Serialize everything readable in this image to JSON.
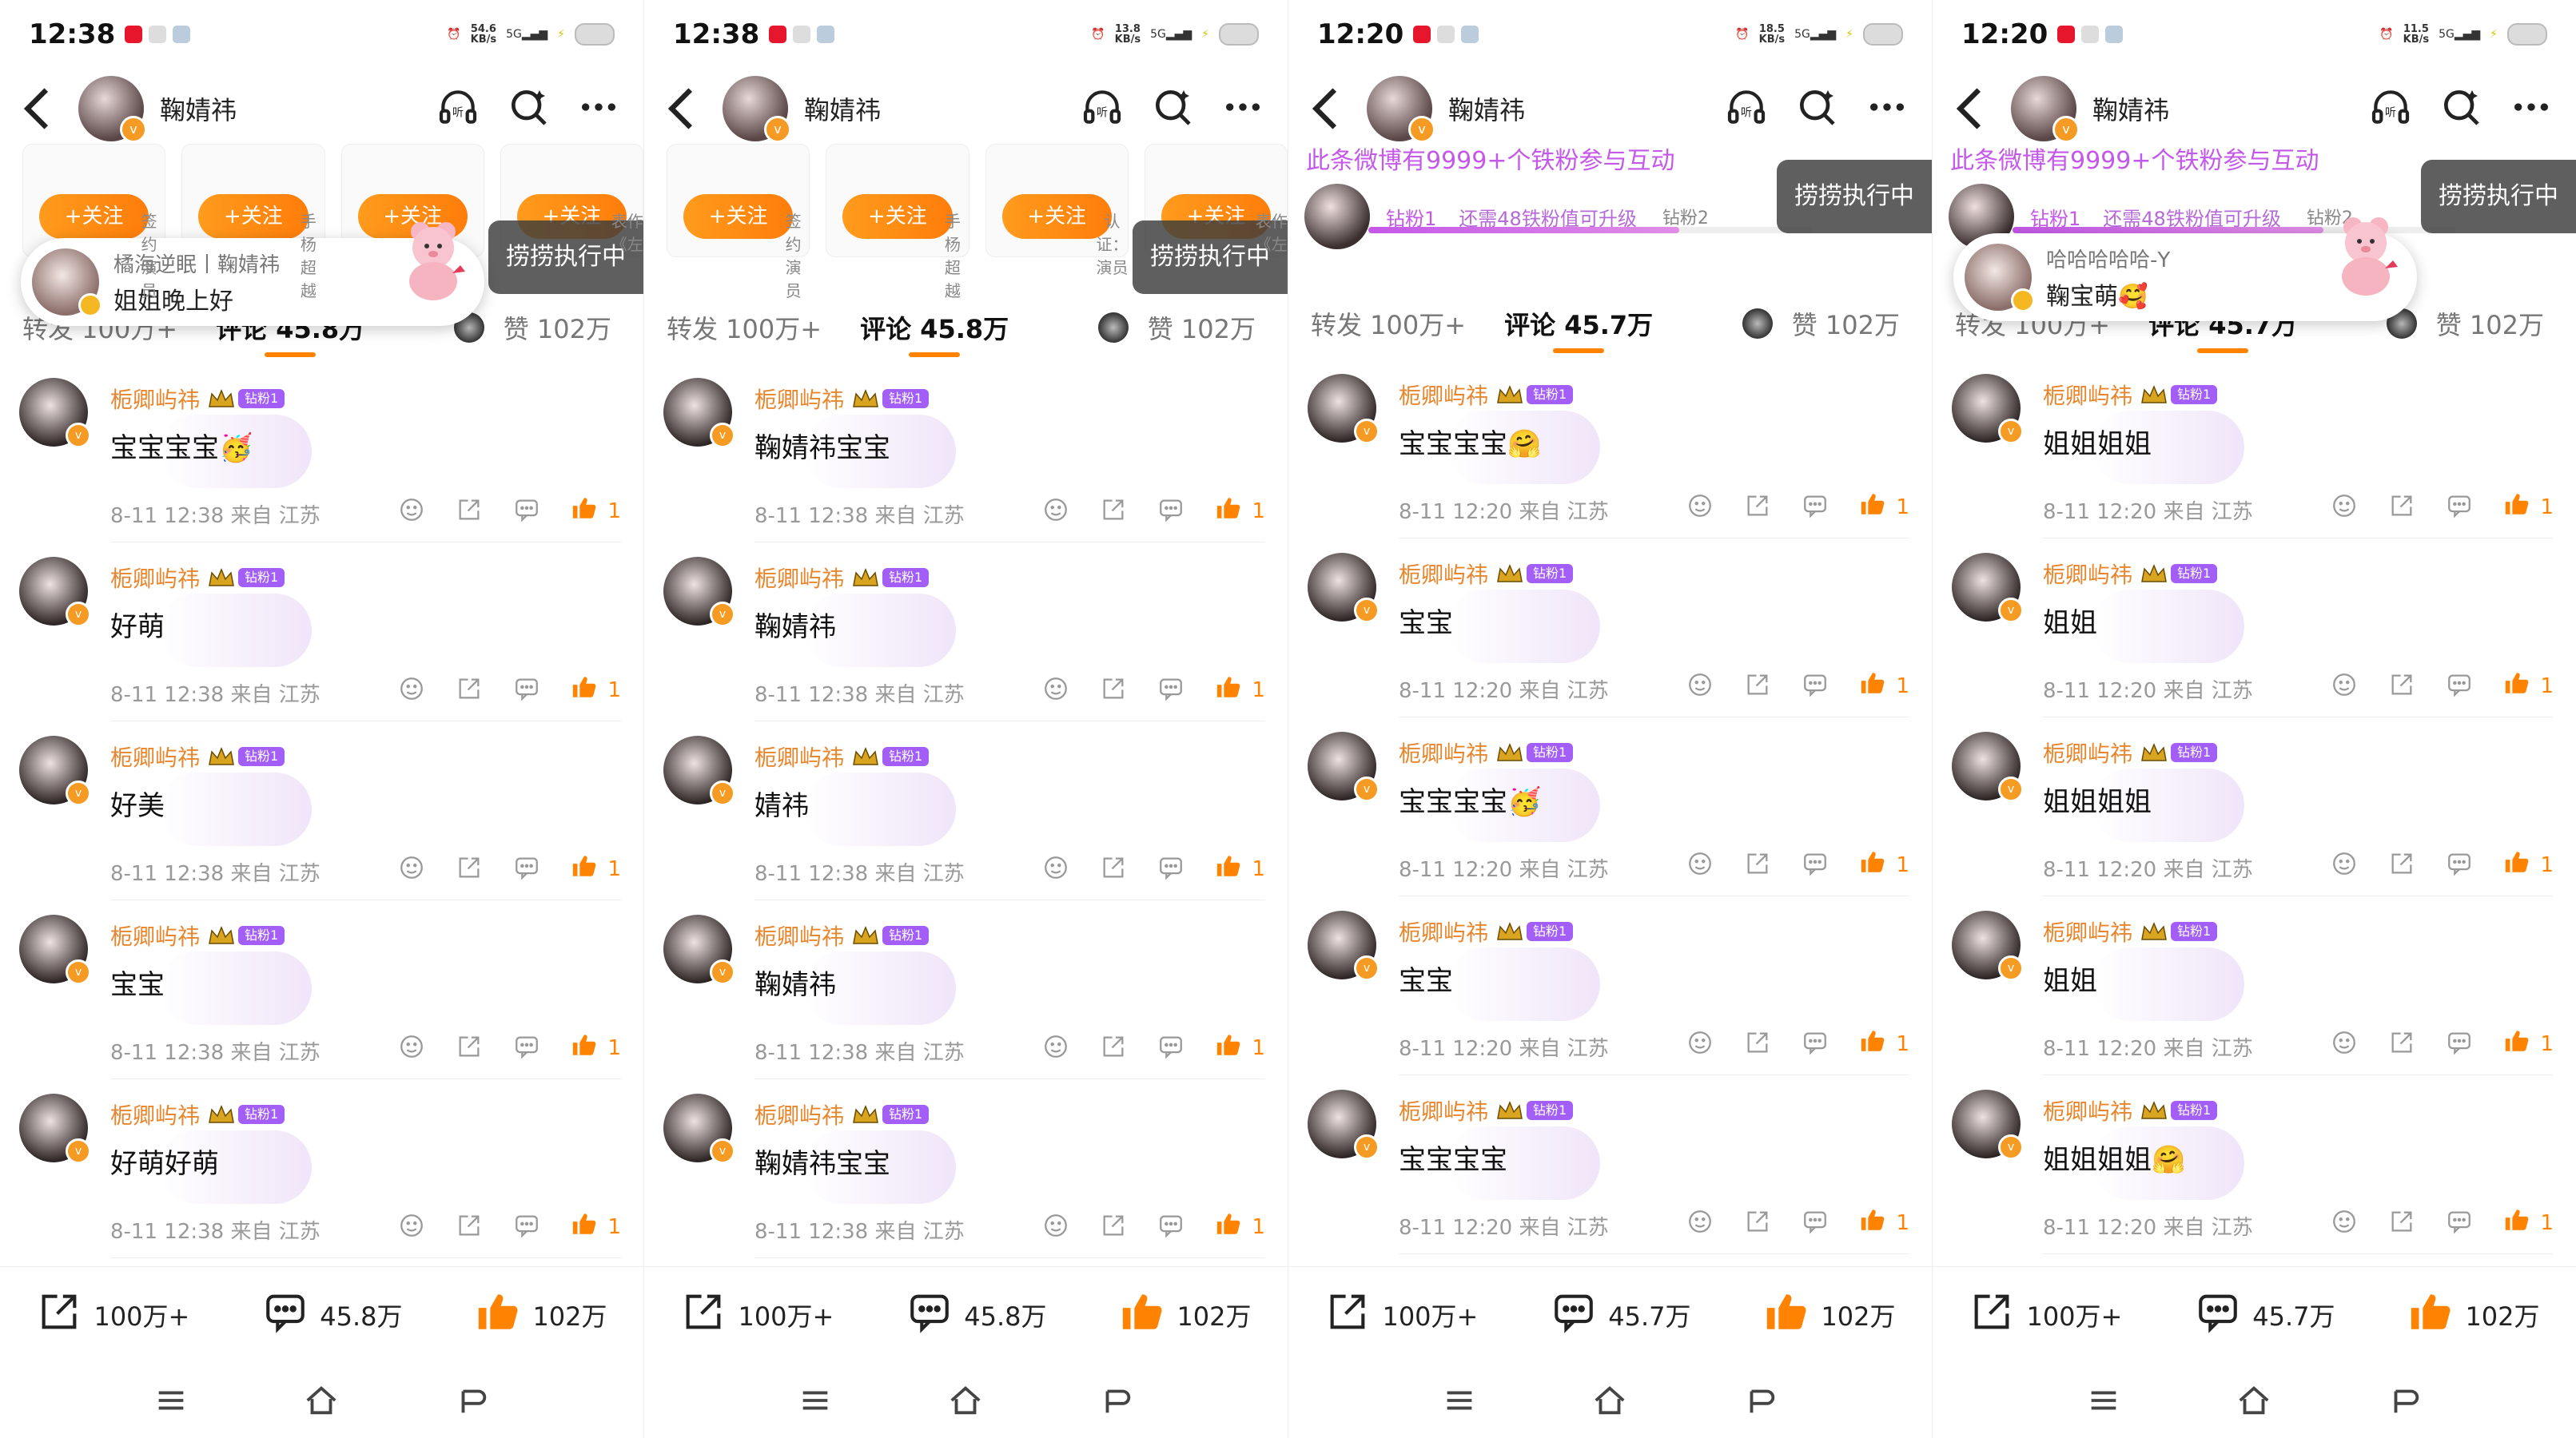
{
  "status_colors": {
    "accent": "#ff8200",
    "fan_purple": "#c458e8",
    "name_orange": "#e8862d"
  },
  "phones": [
    {
      "time": "12:38",
      "speed": "54.6\nKB/s",
      "username": "鞠婧祎",
      "banner": "cards",
      "cards": [
        "签约演员",
        "手杨超越",
        "",
        "表作《左"
      ],
      "follow_label": "+关注",
      "exec_label": "捞捞执行中",
      "popup": {
        "name": "橘海逆眠丨鞠婧祎",
        "msg": "姐姐晚上好"
      },
      "tabs": {
        "repost": "转发 100万+",
        "comments": "评论 45.8万",
        "likes": "赞 102万"
      },
      "comments": [
        {
          "name": "栀卿屿祎",
          "text": "宝宝宝宝🥳",
          "meta": "8-11 12:38 来自 江苏",
          "likes": "1"
        },
        {
          "name": "栀卿屿祎",
          "text": "好萌",
          "meta": "8-11 12:38 来自 江苏",
          "likes": "1"
        },
        {
          "name": "栀卿屿祎",
          "text": "好美",
          "meta": "8-11 12:38 来自 江苏",
          "likes": "1"
        },
        {
          "name": "栀卿屿祎",
          "text": "宝宝",
          "meta": "8-11 12:38 来自 江苏",
          "likes": "1"
        },
        {
          "name": "栀卿屿祎",
          "text": "好萌好萌",
          "meta": "8-11 12:38 来自 江苏",
          "likes": "1"
        }
      ],
      "bottom": {
        "repost": "100万+",
        "comments": "45.8万",
        "likes": "102万"
      }
    },
    {
      "time": "12:38",
      "speed": "13.8\nKB/s",
      "username": "鞠婧祎",
      "banner": "cards",
      "cards": [
        "签约演员",
        "手杨超越",
        "认证：演员",
        "表作《左"
      ],
      "follow_label": "+关注",
      "exec_label": "捞捞执行中",
      "tabs": {
        "repost": "转发 100万+",
        "comments": "评论 45.8万",
        "likes": "赞 102万"
      },
      "comments": [
        {
          "name": "栀卿屿祎",
          "text": "鞠婧祎宝宝",
          "meta": "8-11 12:38 来自 江苏",
          "likes": "1"
        },
        {
          "name": "栀卿屿祎",
          "text": "鞠婧祎",
          "meta": "8-11 12:38 来自 江苏",
          "likes": "1"
        },
        {
          "name": "栀卿屿祎",
          "text": "婧祎",
          "meta": "8-11 12:38 来自 江苏",
          "likes": "1"
        },
        {
          "name": "栀卿屿祎",
          "text": "鞠婧祎",
          "meta": "8-11 12:38 来自 江苏",
          "likes": "1"
        },
        {
          "name": "栀卿屿祎",
          "text": "鞠婧祎宝宝",
          "meta": "8-11 12:38 来自 江苏",
          "likes": "1"
        }
      ],
      "bottom": {
        "repost": "100万+",
        "comments": "45.8万",
        "likes": "102万"
      }
    },
    {
      "time": "12:20",
      "speed": "18.5\nKB/s",
      "username": "鞠婧祎",
      "banner": "fan",
      "fan_title": "此条微博有9999+个铁粉参与互动",
      "fan_level": "钻粉1",
      "fan_next": "还需48铁粉值可升级",
      "fan_level2": "钻粉2",
      "fan_progress": 0.7,
      "exec_label": "捞捞执行中",
      "tabs": {
        "repost": "转发 100万+",
        "comments": "评论 45.7万",
        "likes": "赞 102万"
      },
      "comments": [
        {
          "name": "栀卿屿祎",
          "text": "宝宝宝宝🤗",
          "meta": "8-11 12:20 来自 江苏",
          "likes": "1"
        },
        {
          "name": "栀卿屿祎",
          "text": "宝宝",
          "meta": "8-11 12:20 来自 江苏",
          "likes": "1"
        },
        {
          "name": "栀卿屿祎",
          "text": "宝宝宝宝🥳",
          "meta": "8-11 12:20 来自 江苏",
          "likes": "1"
        },
        {
          "name": "栀卿屿祎",
          "text": "宝宝",
          "meta": "8-11 12:20 来自 江苏",
          "likes": "1"
        },
        {
          "name": "栀卿屿祎",
          "text": "宝宝宝宝",
          "meta": "8-11 12:20 来自 江苏",
          "likes": "1"
        }
      ],
      "bottom": {
        "repost": "100万+",
        "comments": "45.7万",
        "likes": "102万"
      }
    },
    {
      "time": "12:20",
      "speed": "11.5\nKB/s",
      "username": "鞠婧祎",
      "banner": "fan",
      "fan_title": "此条微博有9999+个铁粉参与互动",
      "fan_level": "钻粉1",
      "fan_next": "还需48铁粉值可升级",
      "fan_level2": "钻粉2",
      "fan_progress": 0.7,
      "exec_label": "捞捞执行中",
      "popup": {
        "name": "哈哈哈哈哈-Y",
        "msg": "鞠宝萌🥰"
      },
      "tabs": {
        "repost": "转发 100万+",
        "comments": "评论 45.7万",
        "likes": "赞 102万"
      },
      "comments": [
        {
          "name": "栀卿屿祎",
          "text": "姐姐姐姐",
          "meta": "8-11 12:20 来自 江苏",
          "likes": "1"
        },
        {
          "name": "栀卿屿祎",
          "text": "姐姐",
          "meta": "8-11 12:20 来自 江苏",
          "likes": "1"
        },
        {
          "name": "栀卿屿祎",
          "text": "姐姐姐姐",
          "meta": "8-11 12:20 来自 江苏",
          "likes": "1"
        },
        {
          "name": "栀卿屿祎",
          "text": "姐姐",
          "meta": "8-11 12:20 来自 江苏",
          "likes": "1"
        },
        {
          "name": "栀卿屿祎",
          "text": "姐姐姐姐🤗",
          "meta": "8-11 12:20 来自 江苏",
          "likes": "1"
        }
      ],
      "bottom": {
        "repost": "100万+",
        "comments": "45.7万",
        "likes": "102万"
      }
    }
  ]
}
